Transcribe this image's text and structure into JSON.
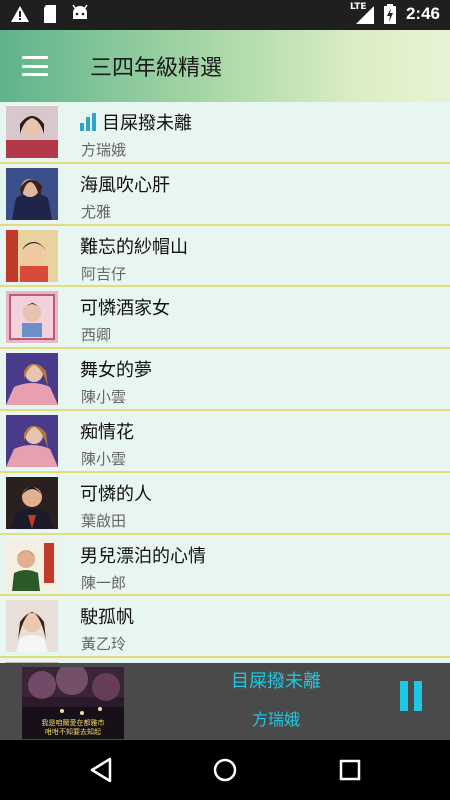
{
  "status_bar": {
    "time": "2:46",
    "network": "LTE",
    "battery": "2",
    "icons": [
      "warning-icon",
      "sd-card-icon",
      "android-icon",
      "signal-icon",
      "battery-charging-icon"
    ]
  },
  "app_bar": {
    "title": "三四年級精選",
    "menu_icon": "hamburger-menu-icon"
  },
  "songs": [
    {
      "title": "目屎撥未離",
      "artist": "方瑞娥",
      "playing": true
    },
    {
      "title": "海風吹心肝",
      "artist": "尤雅"
    },
    {
      "title": "難忘的紗帽山",
      "artist": "阿吉仔"
    },
    {
      "title": "可憐酒家女",
      "artist": "西卿"
    },
    {
      "title": "舞女的夢",
      "artist": "陳小雲"
    },
    {
      "title": "痴情花",
      "artist": "陳小雲"
    },
    {
      "title": "可憐的人",
      "artist": "葉啟田"
    },
    {
      "title": "男兒漂泊的心情",
      "artist": "陳一郎"
    },
    {
      "title": "駛孤帆",
      "artist": "黃乙玲"
    }
  ],
  "now_playing": {
    "title": "目屎撥未離",
    "artist": "方瑞娥",
    "cover_caption_line1": "我是咱爾愛在都雅市",
    "cover_caption_line2": "咁咁不知要去知起",
    "control_icon": "pause-icon"
  },
  "colors": {
    "accent": "#1ec7e3",
    "list_background": "#e8f6f2",
    "divider": "#e4dc7a",
    "eq_icon": "#2ea5c9"
  },
  "nav_bar": {
    "icons": [
      "back-icon",
      "home-icon",
      "recents-icon"
    ]
  }
}
